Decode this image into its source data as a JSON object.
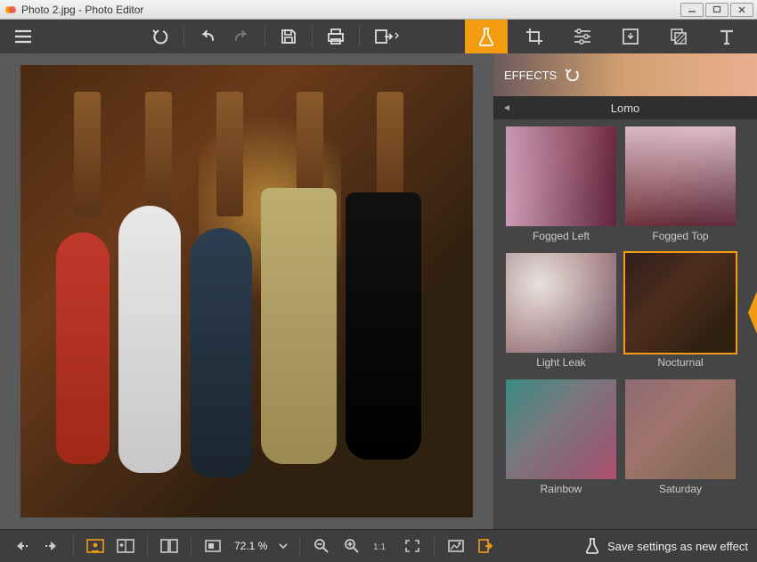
{
  "window": {
    "title": "Photo 2.jpg - Photo Editor"
  },
  "tool_tabs": [
    {
      "name": "effects",
      "icon": "flask-icon",
      "active": true
    },
    {
      "name": "crop",
      "icon": "crop-icon",
      "active": false
    },
    {
      "name": "adjust",
      "icon": "sliders-icon",
      "active": false
    },
    {
      "name": "frames",
      "icon": "frame-icon",
      "active": false
    },
    {
      "name": "textures",
      "icon": "texture-icon",
      "active": false
    },
    {
      "name": "text",
      "icon": "text-icon",
      "active": false
    }
  ],
  "effects_panel": {
    "title": "EFFECTS",
    "category": "Lomo",
    "thumbnails": [
      {
        "label": "Fogged Left",
        "selected": false,
        "fill": "tf-fogleft"
      },
      {
        "label": "Fogged Top",
        "selected": false,
        "fill": "tf-fogtop"
      },
      {
        "label": "Light Leak",
        "selected": false,
        "fill": "tf-light"
      },
      {
        "label": "Nocturnal",
        "selected": true,
        "fill": "tf-noct"
      },
      {
        "label": "Rainbow",
        "selected": false,
        "fill": "tf-rainbow"
      },
      {
        "label": "Saturday",
        "selected": false,
        "fill": "tf-saturday"
      }
    ]
  },
  "bottom": {
    "zoom": "72.1 %",
    "save_effect_label": "Save settings as new effect"
  },
  "colors": {
    "accent": "#f39c12"
  }
}
